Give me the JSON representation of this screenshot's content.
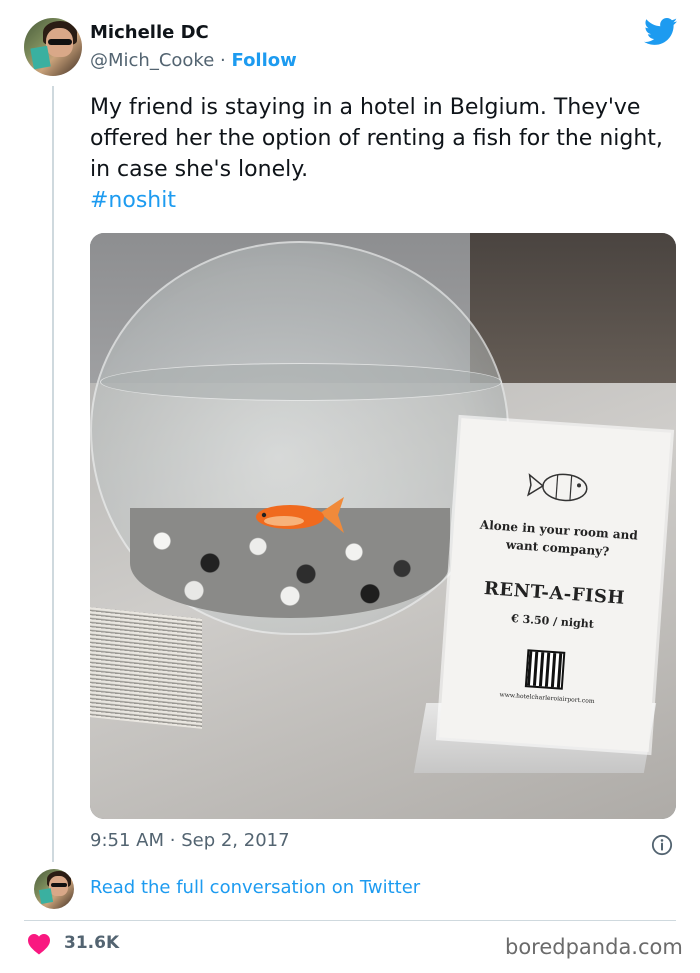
{
  "author": {
    "display_name": "Michelle DC",
    "handle": "@Mich_Cooke",
    "separator": "·",
    "follow_label": "Follow"
  },
  "tweet": {
    "text": "My friend is staying in a hotel in Belgium. They've offered her the option of renting a fish for the night, in case she's lonely.",
    "hashtag": "#noshit",
    "time": "9:51 AM",
    "separator": "·",
    "date": "Sep 2, 2017",
    "read_more": "Read the full conversation on Twitter",
    "likes": "31.6K"
  },
  "photo_sign": {
    "line1": "Alone in your room and",
    "line2": "want company?",
    "title": "RENT-A-FISH",
    "price": "€ 3.50 / night",
    "url": "www.hotelcharleroiairport.com"
  },
  "watermark": "boredpanda.com",
  "colors": {
    "accent": "#1d9bf0",
    "heart": "#f91880",
    "muted": "#536471"
  },
  "icons": [
    "twitter-bird-icon",
    "info-icon",
    "heart-icon"
  ]
}
